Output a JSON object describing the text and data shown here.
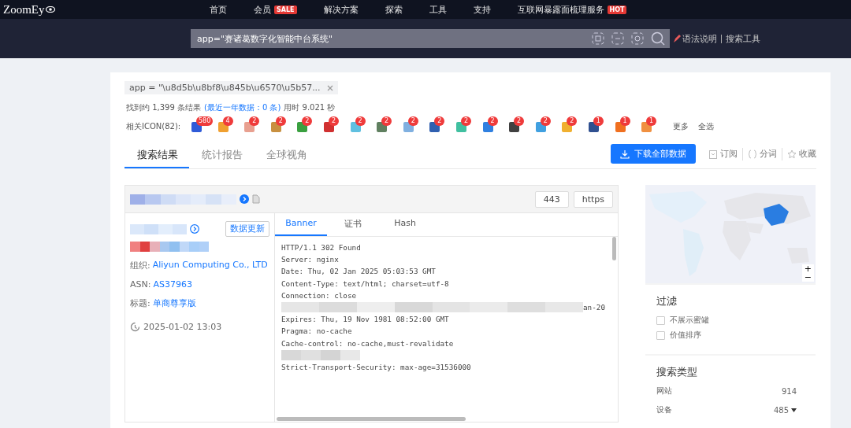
{
  "nav": {
    "logo": "ZoomEy",
    "items": [
      {
        "label": "首页"
      },
      {
        "label": "会员",
        "badge": "SALE"
      },
      {
        "label": "解决方案"
      },
      {
        "label": "探索"
      },
      {
        "label": "工具"
      },
      {
        "label": "支持"
      },
      {
        "label": "互联网暴露面梳理服务",
        "badge": "HOT"
      }
    ]
  },
  "search": {
    "value": "app=\"赛诸葛数字化智能中台系统\"",
    "links": [
      "语法说明",
      "搜索工具"
    ]
  },
  "query_tag": "app = \"\\u8d5b\\u8bf8\\u845b\\u6570\\u5b57...",
  "summary": {
    "found": "找到约 1,399 条结果",
    "recent": "(最近一年数据：0 条)",
    "time": "用时 9.021 秒"
  },
  "icons": {
    "label": "相关ICON(82):",
    "items": [
      {
        "count": "580",
        "color": "#2f5bd8"
      },
      {
        "count": "4",
        "color": "#f0a030"
      },
      {
        "count": "2",
        "color": "#e8a090"
      },
      {
        "count": "2",
        "color": "#c89040"
      },
      {
        "count": "2",
        "color": "#3aa040"
      },
      {
        "count": "2",
        "color": "#d03030"
      },
      {
        "count": "2",
        "color": "#60c0e0"
      },
      {
        "count": "2",
        "color": "#608060"
      },
      {
        "count": "2",
        "color": "#80b0e0"
      },
      {
        "count": "2",
        "color": "#3060b0"
      },
      {
        "count": "2",
        "color": "#40c0a0"
      },
      {
        "count": "2",
        "color": "#3080e0"
      },
      {
        "count": "2",
        "color": "#404040"
      },
      {
        "count": "2",
        "color": "#40a0e0"
      },
      {
        "count": "2",
        "color": "#f0b030"
      },
      {
        "count": "1",
        "color": "#305090"
      },
      {
        "count": "1",
        "color": "#f07020"
      },
      {
        "count": "1",
        "color": "#f09040"
      }
    ],
    "more": "更多",
    "all": "全选"
  },
  "tabs": [
    {
      "label": "搜索结果",
      "selected": true
    },
    {
      "label": "统计报告",
      "selected": false
    },
    {
      "label": "全球视角",
      "selected": false
    }
  ],
  "download": "下载全部数据",
  "actions": [
    "订阅",
    "分词",
    "收藏"
  ],
  "result": {
    "ports": [
      "443",
      "https"
    ],
    "update": "数据更新",
    "org_label": "组织:",
    "org": "Aliyun Computing Co., LTD",
    "asn_label": "ASN:",
    "asn": "AS37963",
    "title_label": "标题:",
    "title": "单商尊享版",
    "time": "2025-01-02 13:03",
    "banner_tabs": [
      {
        "label": "Banner",
        "selected": true
      },
      {
        "label": "证书",
        "selected": false
      },
      {
        "label": "Hash",
        "selected": false
      }
    ],
    "lines": [
      {
        "kind": "text",
        "text": "HTTP/1.1 302 Found"
      },
      {
        "kind": "text",
        "text": "Server: nginx"
      },
      {
        "kind": "text",
        "text": "Date: Thu, 02 Jan 2025 05:03:53 GMT"
      },
      {
        "kind": "text",
        "text": "Content-Type: text/html; charset=utf-8"
      },
      {
        "kind": "text",
        "text": "Connection: close"
      },
      {
        "kind": "redacted",
        "tail": "an-20"
      },
      {
        "kind": "text",
        "text": "Expires: Thu, 19 Nov 1981 08:52:00 GMT"
      },
      {
        "kind": "text",
        "text": "Pragma: no-cache"
      },
      {
        "kind": "text",
        "text": "Cache-control: no-cache,must-revalidate"
      },
      {
        "kind": "redacted"
      },
      {
        "kind": "text",
        "text": "Strict-Transport-Security: max-age=31536000"
      }
    ]
  },
  "map_zoom": [
    "+",
    "−"
  ],
  "filter": {
    "title": "过滤",
    "options": [
      {
        "label": "不展示蜜罐",
        "checked": false
      },
      {
        "label": "价值排序",
        "checked": false
      }
    ]
  },
  "types": {
    "title": "搜索类型",
    "rows": [
      {
        "label": "网站",
        "count": "914",
        "caret": false
      },
      {
        "label": "设备",
        "count": "485",
        "caret": true
      }
    ]
  }
}
